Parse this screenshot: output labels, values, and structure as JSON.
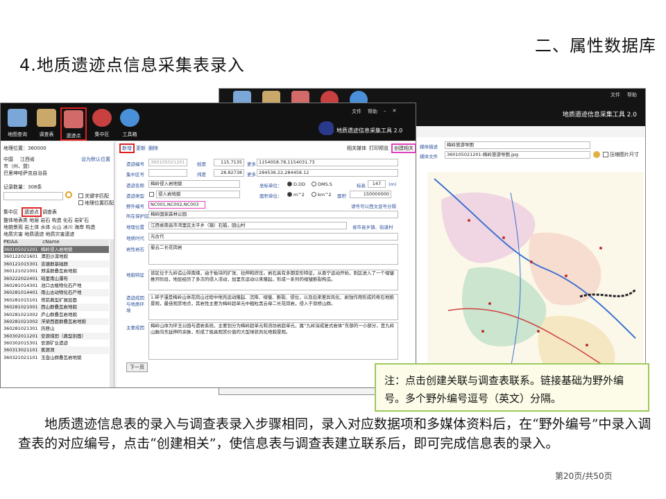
{
  "slide": {
    "section_title": "二、属性数据库",
    "title": "4.地质遗迹点信息采集表录入",
    "note": "注：点击创建关联与调查表联系。链接基础为野外编号。多个野外编号逗号（英文）分隔。",
    "body": "地质遗迹信息表的录入与调查表录入步骤相同，录入对应数据项和多媒体资料后，在“野外编号”中录入调查表的对应编号，点击“创建相关”，使信息表与调查表建立联系后，即可完成信息表的录入。",
    "page_number": "第20页/共50页"
  },
  "back_window": {
    "menu": [
      "文件",
      "帮助"
    ],
    "app_title": "地质遗迹信息采集工具 2.0",
    "tabs": [
      "相关媒体",
      "打印预览",
      "创建相关"
    ],
    "media_desc_label": "媒体描述",
    "media_desc_value": "梅岭旅游导图",
    "media_file_label": "媒体文件",
    "media_file_value": "360105021201-梅岭旅游导图.jpg",
    "compress_label": "压缩图片尺寸"
  },
  "front_window": {
    "menu": [
      "文件",
      "帮助"
    ],
    "app_title": "地质遗迹信息采集工具 2.0",
    "toolbar": [
      {
        "label": "地图查询",
        "icon": "map-query-icon",
        "color": "#7aa6d8"
      },
      {
        "label": "调查表",
        "icon": "survey-form-icon",
        "color": "#c9a86a"
      },
      {
        "label": "遗迹点",
        "icon": "heritage-point-icon",
        "color": "#d26a6a"
      },
      {
        "label": "集中区",
        "icon": "concentration-area-icon",
        "color": "#c84040"
      },
      {
        "label": "工具箱",
        "icon": "toolbox-icon",
        "color": "#4a90d9"
      }
    ],
    "left": {
      "location_label": "地理位置：360000",
      "region": [
        "中国",
        "江西省",
        "市（州、盟）",
        "巴里坤哈萨克自治县"
      ],
      "set_default": "设为默认位置",
      "record_count": "记录数量：308条",
      "keyword_match": "关键字匹配",
      "location_match": "地理位置匹配",
      "tab_row": [
        "集中区",
        "遗迹点",
        "调查表"
      ],
      "filter_rows": [
        "整体地表类 地层 岩石 构造 化石 岩矿石",
        "地貌景观 岩土体 水体 火山 冰川 海岸 构造",
        "地质灾害 地质遗迹 地质灾害遗迹"
      ],
      "table_header": [
        "PKIAA",
        "cName"
      ],
      "rows": [
        [
          "360105021201",
          "梅岭侵入岩地貌"
        ],
        [
          "360122021601",
          "潭田沙漠地貌"
        ],
        [
          "360121015301",
          "吉塘群基础群"
        ],
        [
          "360121021001",
          "郑溪群叠瓦岩地貌"
        ],
        [
          "360222022401",
          "瑶里南山瀑布"
        ],
        [
          "360281014301",
          "池口古植物化石产地"
        ],
        [
          "360281014401",
          "南山古动物化石产地"
        ],
        [
          "360281015101",
          "塔前典型扩展层面"
        ],
        [
          "360281021001",
          "西山群叠瓦岩地貌"
        ],
        [
          "360281021002",
          "庐山群叠瓦岩地貌"
        ],
        [
          "360281021002",
          "浮梁西面群叠瓦岩地貌"
        ],
        [
          "360281021301",
          "历居山"
        ],
        [
          "360302011201",
          "安源煤田（典型剖面）"
        ],
        [
          "360302015301",
          "安源矿业遗迹"
        ],
        [
          "360313021101",
          "蕉源洞"
        ],
        [
          "360321021101",
          "玉壶山群叠瓦岩地貌"
        ]
      ]
    },
    "form": {
      "actions": [
        "新增",
        "更新",
        "删除"
      ],
      "right_tabs": [
        "相关媒体",
        "打印预览",
        "创建相关"
      ],
      "labels": {
        "code": "遗迹编号",
        "area": "集中区号",
        "name": "遗迹名称",
        "type": "遗迹类型",
        "field_no": "野外编号",
        "park": "所在保护区(公园)",
        "address": "地理位置",
        "era": "地质时代",
        "rock": "岩性岩石",
        "desc": "地貌特征",
        "formation": "遗迹成因与地质环境",
        "value": "主要成因"
      },
      "code_value": "360105021201",
      "lon_label": "经度",
      "lon_value": "115.7135",
      "more": "更多",
      "lon_more_value": "1154058.78,1154031.73",
      "lat_label": "纬度",
      "lat_value": "28.82738",
      "lat_more_value": "284536.22,284458.12",
      "name_value": "梅岭侵入岩地貌",
      "coord_label": "坐标单位：",
      "coord_dd": "D.DD",
      "coord_dms": "DMS.S",
      "elev_label": "标高",
      "elev_value": "147",
      "elev_unit": "(m)",
      "type_value": "侵入岩地貌",
      "area_unit_label": "面积单位：",
      "area_m2": "m^2",
      "area_km2": "km^2",
      "area_label": "面积",
      "area_value": "150000000",
      "field_no_value": "NC001,NC002,NC003",
      "field_no_hint": "请号可以西文逗号分隔",
      "park_value": "梅岭国家森林公园",
      "address_value": "江西省南昌市湾里区太平乡（镇）石鼓，园山村",
      "address_hint": "省市县乡镇、街道村",
      "era_value": "元古代",
      "rock_value": "晕云二长花岗岩",
      "desc_value": "该区位于九岭造山带南缘，由于板块的扩张、拉伸和挤压，岩石具有多期变形特征，从晋宁运动开始，则区进入了一个褶皱推开阶段，地层经历了多次的侵入活动，加里东运动以来隆起，形成一系列的褶皱断裂构造。",
      "formation_value": "1.碎子漫是梅岭山体花岗山过程中地壳运动隆起、沉降、褶皱、断裂、侵位，以及后来差异风化、剥蚀作用形成的奇石地貌景观，最佳观赏地点，其岩性主要为梅岭超单元中粗粒黑云母二长花岗岩，侵入于双桥山群。",
      "value_value": "梅岭山体为环玉公园与遗岩系统，主要划分为梅岭超单元和流坊岩超单元，属“九岭深成复式岩体”东部的一小部分，是九岭山脉向东延伸的余脉，形成了极具观赏价值的大型球状风化地貌景观。",
      "next_button": "下一页"
    }
  },
  "colors": {
    "highlight_red": "#e02020",
    "highlight_magenta": "#e040c0",
    "note_border": "#9bc95b",
    "toolbar_bg": "#111111"
  }
}
